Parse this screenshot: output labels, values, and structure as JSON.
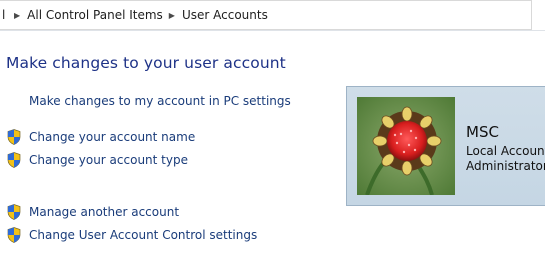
{
  "breadcrumb": {
    "first_stub": "l",
    "items": [
      "All Control Panel Items",
      "User Accounts"
    ]
  },
  "heading": "Make changes to your user account",
  "links": {
    "pc_settings": "Make changes to my account in PC settings",
    "change_name": "Change your account name",
    "change_type": "Change your account type",
    "manage_other": "Manage another account",
    "uac_settings": "Change User Account Control settings"
  },
  "account": {
    "name": "MSC",
    "type": "Local Account",
    "role": "Administrator"
  },
  "icons": {
    "shield": "uac-shield-icon",
    "separator": "chevron-right-icon"
  },
  "colors": {
    "heading": "#1e3287",
    "link": "#1a3c7a",
    "tile_bg": "#c5d6e4"
  }
}
